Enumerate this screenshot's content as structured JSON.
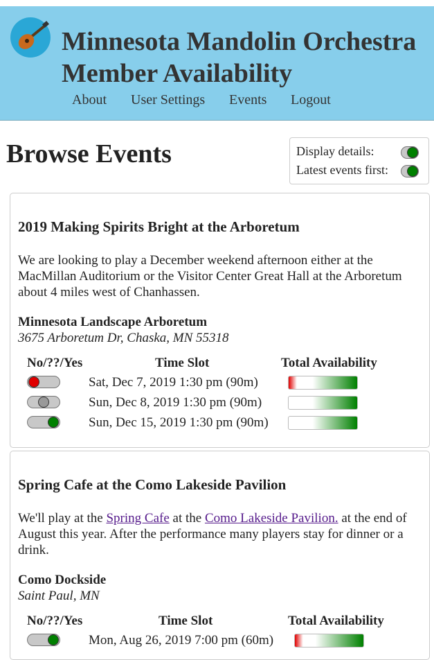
{
  "header": {
    "title_line1": "Minnesota Mandolin Orchestra",
    "title_line2": "Member Availability",
    "nav": [
      "About",
      "User Settings",
      "Events",
      "Logout"
    ]
  },
  "page": {
    "heading": "Browse Events",
    "display_details_label": "Display details:",
    "latest_first_label": "Latest events first:",
    "display_details_on": true,
    "latest_first_on": true
  },
  "columns": {
    "response": "No/??/Yes",
    "slot": "Time Slot",
    "availability": "Total Availability"
  },
  "events": [
    {
      "title": "2019 Making Spirits Bright at the Arboretum",
      "description": "We are looking to play a December weekend afternoon either at the MacMillan Auditorium or the Visitor Center Great Hall at the Arboretum about 4 miles west of Chanhassen.",
      "venue": "Minnesota Landscape Arboretum",
      "address": "3675 Arboretum Dr, Chaska, MN 55318",
      "slots": [
        {
          "label": "Sat, Dec 7, 2019 1:30 pm (90m)",
          "response": "no"
        },
        {
          "label": "Sun, Dec 8, 2019 1:30 pm (90m)",
          "response": "maybe"
        },
        {
          "label": "Sun, Dec 15, 2019 1:30 pm (90m)",
          "response": "yes"
        }
      ]
    },
    {
      "title": "Spring Cafe at the Como Lakeside Pavilion",
      "description_parts": {
        "pre": "We'll play at the ",
        "link1": "Spring Cafe",
        "mid": " at the ",
        "link2": "Como Lakeside Pavilion.",
        "post": " at the end of August this year. After the performance many players stay for dinner or a drink."
      },
      "venue": "Como Dockside",
      "address": "Saint Paul, MN",
      "slots": [
        {
          "label": "Mon, Aug 26, 2019 7:00 pm (60m)",
          "response": "yes"
        }
      ]
    }
  ],
  "colors": {
    "header_bg": "#87ceeb",
    "no": "#e00000",
    "maybe": "#999999",
    "yes": "#008000",
    "link": "#551a8b"
  }
}
